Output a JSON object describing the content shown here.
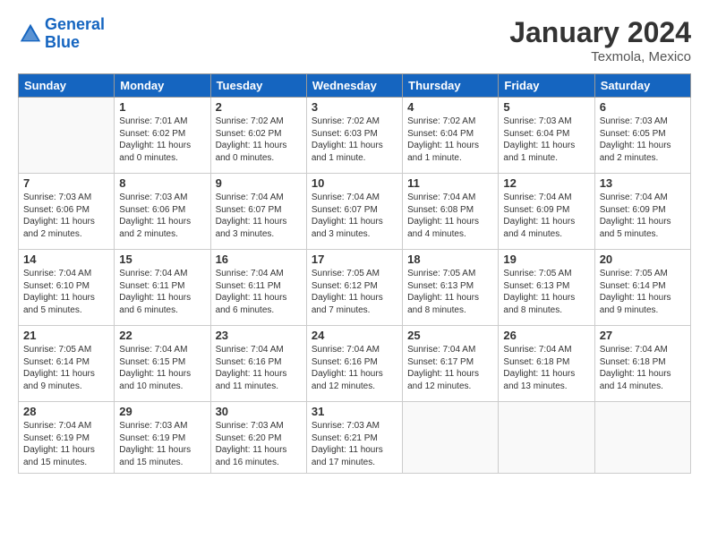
{
  "header": {
    "logo_line1": "General",
    "logo_line2": "Blue",
    "title": "January 2024",
    "subtitle": "Texmola, Mexico"
  },
  "days_of_week": [
    "Sunday",
    "Monday",
    "Tuesday",
    "Wednesday",
    "Thursday",
    "Friday",
    "Saturday"
  ],
  "weeks": [
    [
      {
        "num": "",
        "info": ""
      },
      {
        "num": "1",
        "info": "Sunrise: 7:01 AM\nSunset: 6:02 PM\nDaylight: 11 hours\nand 0 minutes."
      },
      {
        "num": "2",
        "info": "Sunrise: 7:02 AM\nSunset: 6:02 PM\nDaylight: 11 hours\nand 0 minutes."
      },
      {
        "num": "3",
        "info": "Sunrise: 7:02 AM\nSunset: 6:03 PM\nDaylight: 11 hours\nand 1 minute."
      },
      {
        "num": "4",
        "info": "Sunrise: 7:02 AM\nSunset: 6:04 PM\nDaylight: 11 hours\nand 1 minute."
      },
      {
        "num": "5",
        "info": "Sunrise: 7:03 AM\nSunset: 6:04 PM\nDaylight: 11 hours\nand 1 minute."
      },
      {
        "num": "6",
        "info": "Sunrise: 7:03 AM\nSunset: 6:05 PM\nDaylight: 11 hours\nand 2 minutes."
      }
    ],
    [
      {
        "num": "7",
        "info": "Sunrise: 7:03 AM\nSunset: 6:06 PM\nDaylight: 11 hours\nand 2 minutes."
      },
      {
        "num": "8",
        "info": "Sunrise: 7:03 AM\nSunset: 6:06 PM\nDaylight: 11 hours\nand 2 minutes."
      },
      {
        "num": "9",
        "info": "Sunrise: 7:04 AM\nSunset: 6:07 PM\nDaylight: 11 hours\nand 3 minutes."
      },
      {
        "num": "10",
        "info": "Sunrise: 7:04 AM\nSunset: 6:07 PM\nDaylight: 11 hours\nand 3 minutes."
      },
      {
        "num": "11",
        "info": "Sunrise: 7:04 AM\nSunset: 6:08 PM\nDaylight: 11 hours\nand 4 minutes."
      },
      {
        "num": "12",
        "info": "Sunrise: 7:04 AM\nSunset: 6:09 PM\nDaylight: 11 hours\nand 4 minutes."
      },
      {
        "num": "13",
        "info": "Sunrise: 7:04 AM\nSunset: 6:09 PM\nDaylight: 11 hours\nand 5 minutes."
      }
    ],
    [
      {
        "num": "14",
        "info": "Sunrise: 7:04 AM\nSunset: 6:10 PM\nDaylight: 11 hours\nand 5 minutes."
      },
      {
        "num": "15",
        "info": "Sunrise: 7:04 AM\nSunset: 6:11 PM\nDaylight: 11 hours\nand 6 minutes."
      },
      {
        "num": "16",
        "info": "Sunrise: 7:04 AM\nSunset: 6:11 PM\nDaylight: 11 hours\nand 6 minutes."
      },
      {
        "num": "17",
        "info": "Sunrise: 7:05 AM\nSunset: 6:12 PM\nDaylight: 11 hours\nand 7 minutes."
      },
      {
        "num": "18",
        "info": "Sunrise: 7:05 AM\nSunset: 6:13 PM\nDaylight: 11 hours\nand 8 minutes."
      },
      {
        "num": "19",
        "info": "Sunrise: 7:05 AM\nSunset: 6:13 PM\nDaylight: 11 hours\nand 8 minutes."
      },
      {
        "num": "20",
        "info": "Sunrise: 7:05 AM\nSunset: 6:14 PM\nDaylight: 11 hours\nand 9 minutes."
      }
    ],
    [
      {
        "num": "21",
        "info": "Sunrise: 7:05 AM\nSunset: 6:14 PM\nDaylight: 11 hours\nand 9 minutes."
      },
      {
        "num": "22",
        "info": "Sunrise: 7:04 AM\nSunset: 6:15 PM\nDaylight: 11 hours\nand 10 minutes."
      },
      {
        "num": "23",
        "info": "Sunrise: 7:04 AM\nSunset: 6:16 PM\nDaylight: 11 hours\nand 11 minutes."
      },
      {
        "num": "24",
        "info": "Sunrise: 7:04 AM\nSunset: 6:16 PM\nDaylight: 11 hours\nand 12 minutes."
      },
      {
        "num": "25",
        "info": "Sunrise: 7:04 AM\nSunset: 6:17 PM\nDaylight: 11 hours\nand 12 minutes."
      },
      {
        "num": "26",
        "info": "Sunrise: 7:04 AM\nSunset: 6:18 PM\nDaylight: 11 hours\nand 13 minutes."
      },
      {
        "num": "27",
        "info": "Sunrise: 7:04 AM\nSunset: 6:18 PM\nDaylight: 11 hours\nand 14 minutes."
      }
    ],
    [
      {
        "num": "28",
        "info": "Sunrise: 7:04 AM\nSunset: 6:19 PM\nDaylight: 11 hours\nand 15 minutes."
      },
      {
        "num": "29",
        "info": "Sunrise: 7:03 AM\nSunset: 6:19 PM\nDaylight: 11 hours\nand 15 minutes."
      },
      {
        "num": "30",
        "info": "Sunrise: 7:03 AM\nSunset: 6:20 PM\nDaylight: 11 hours\nand 16 minutes."
      },
      {
        "num": "31",
        "info": "Sunrise: 7:03 AM\nSunset: 6:21 PM\nDaylight: 11 hours\nand 17 minutes."
      },
      {
        "num": "",
        "info": ""
      },
      {
        "num": "",
        "info": ""
      },
      {
        "num": "",
        "info": ""
      }
    ]
  ]
}
